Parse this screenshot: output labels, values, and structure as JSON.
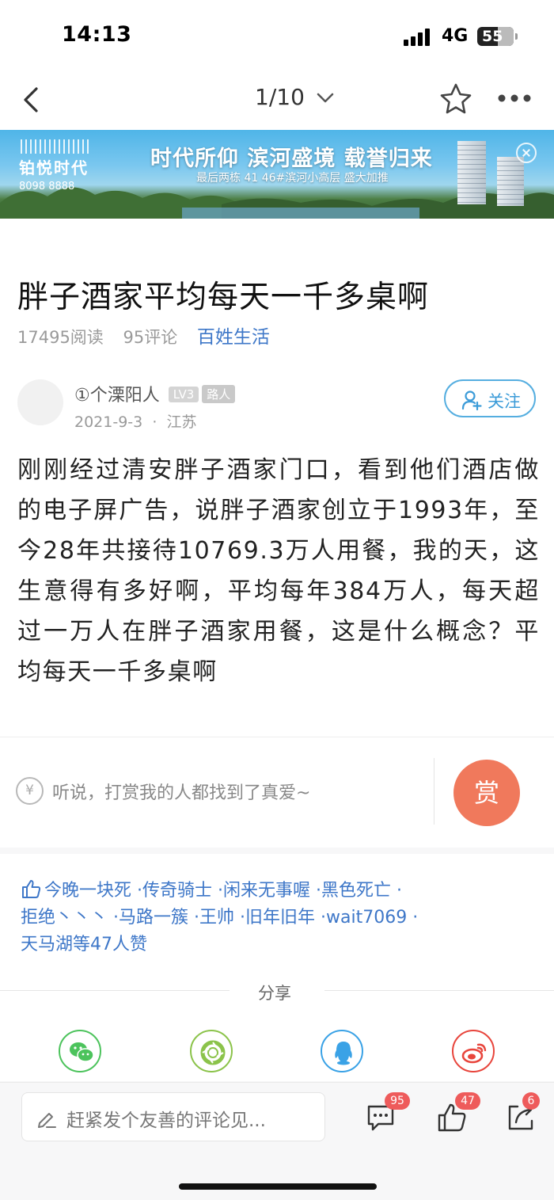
{
  "status_bar": {
    "time": "14:13",
    "network": "4G",
    "battery": "55"
  },
  "nav": {
    "page_indicator": "1/10"
  },
  "banner": {
    "brand": "铂悦时代",
    "phone": "8098 8888",
    "headline": "时代所仰 滨河盛境 载誉归来",
    "subline": "最后两栋 41 46#滨河小高层 盛大加推"
  },
  "article": {
    "title": "胖子酒家平均每天一千多桌啊",
    "reads": "17495阅读",
    "comments": "95评论",
    "category": "百姓生活",
    "author": {
      "name": "①个溧阳人",
      "level": "LV3",
      "role": "路人",
      "date": "2021-9-3",
      "sep": "·",
      "location": "江苏",
      "follow_label": "关注"
    },
    "body": "刚刚经过清安胖子酒家门口，看到他们酒店做的电子屏广告，说胖子酒家创立于1993年，至今28年共接待10769.3万人用餐，我的天，这生意得有多好啊，平均每年384万人，每天超过一万人在胖子酒家用餐，这是什么概念？平均每天一千多桌啊"
  },
  "reward": {
    "yen": "¥",
    "text": "听说，打赏我的人都找到了真爱~",
    "button": "赏"
  },
  "likes": {
    "likers": [
      "今晚一块死",
      "·传奇骑士",
      "·闲来无事喔",
      "·黑色死亡",
      "·",
      "拒绝丶丶丶",
      "·马路一簇",
      "·王帅",
      "·旧年旧年",
      "·wait7069",
      "·",
      "天马湖等47人赞"
    ]
  },
  "share": {
    "label": "分享",
    "targets": [
      "wechat-icon",
      "moments-icon",
      "qq-icon",
      "weibo-icon"
    ],
    "colors": {
      "wechat": "#4cc35c",
      "moments": "#8bc34a",
      "qq": "#3aa2e6",
      "weibo": "#e8453c"
    }
  },
  "bottom_bar": {
    "comment_placeholder": "赶紧发个友善的评论见...",
    "comment_count": "95",
    "like_count": "47",
    "share_count": "6"
  },
  "colors": {
    "accent_blue": "#3e77c8",
    "reward_orange": "#f0795c",
    "badge_red": "#ee5b5b"
  }
}
